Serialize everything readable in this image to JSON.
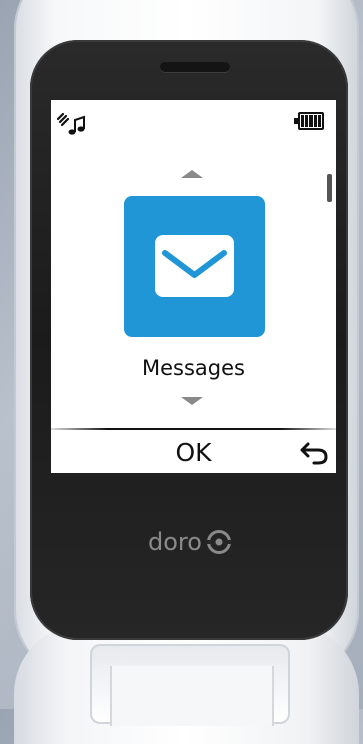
{
  "device": {
    "brand_logo": "doro"
  },
  "status_bar": {
    "left_icon": "vibrate-ring-icon",
    "right_icon": "battery-full-icon",
    "battery_level": 1.0
  },
  "menu": {
    "up_icon": "arrow-up-icon",
    "current_item": {
      "icon": "envelope-icon",
      "label": "Messages",
      "tile_color": "#2196d6"
    },
    "down_icon": "arrow-down-icon"
  },
  "softkeys": {
    "center_label": "OK",
    "right_icon": "back-arrow-icon"
  }
}
